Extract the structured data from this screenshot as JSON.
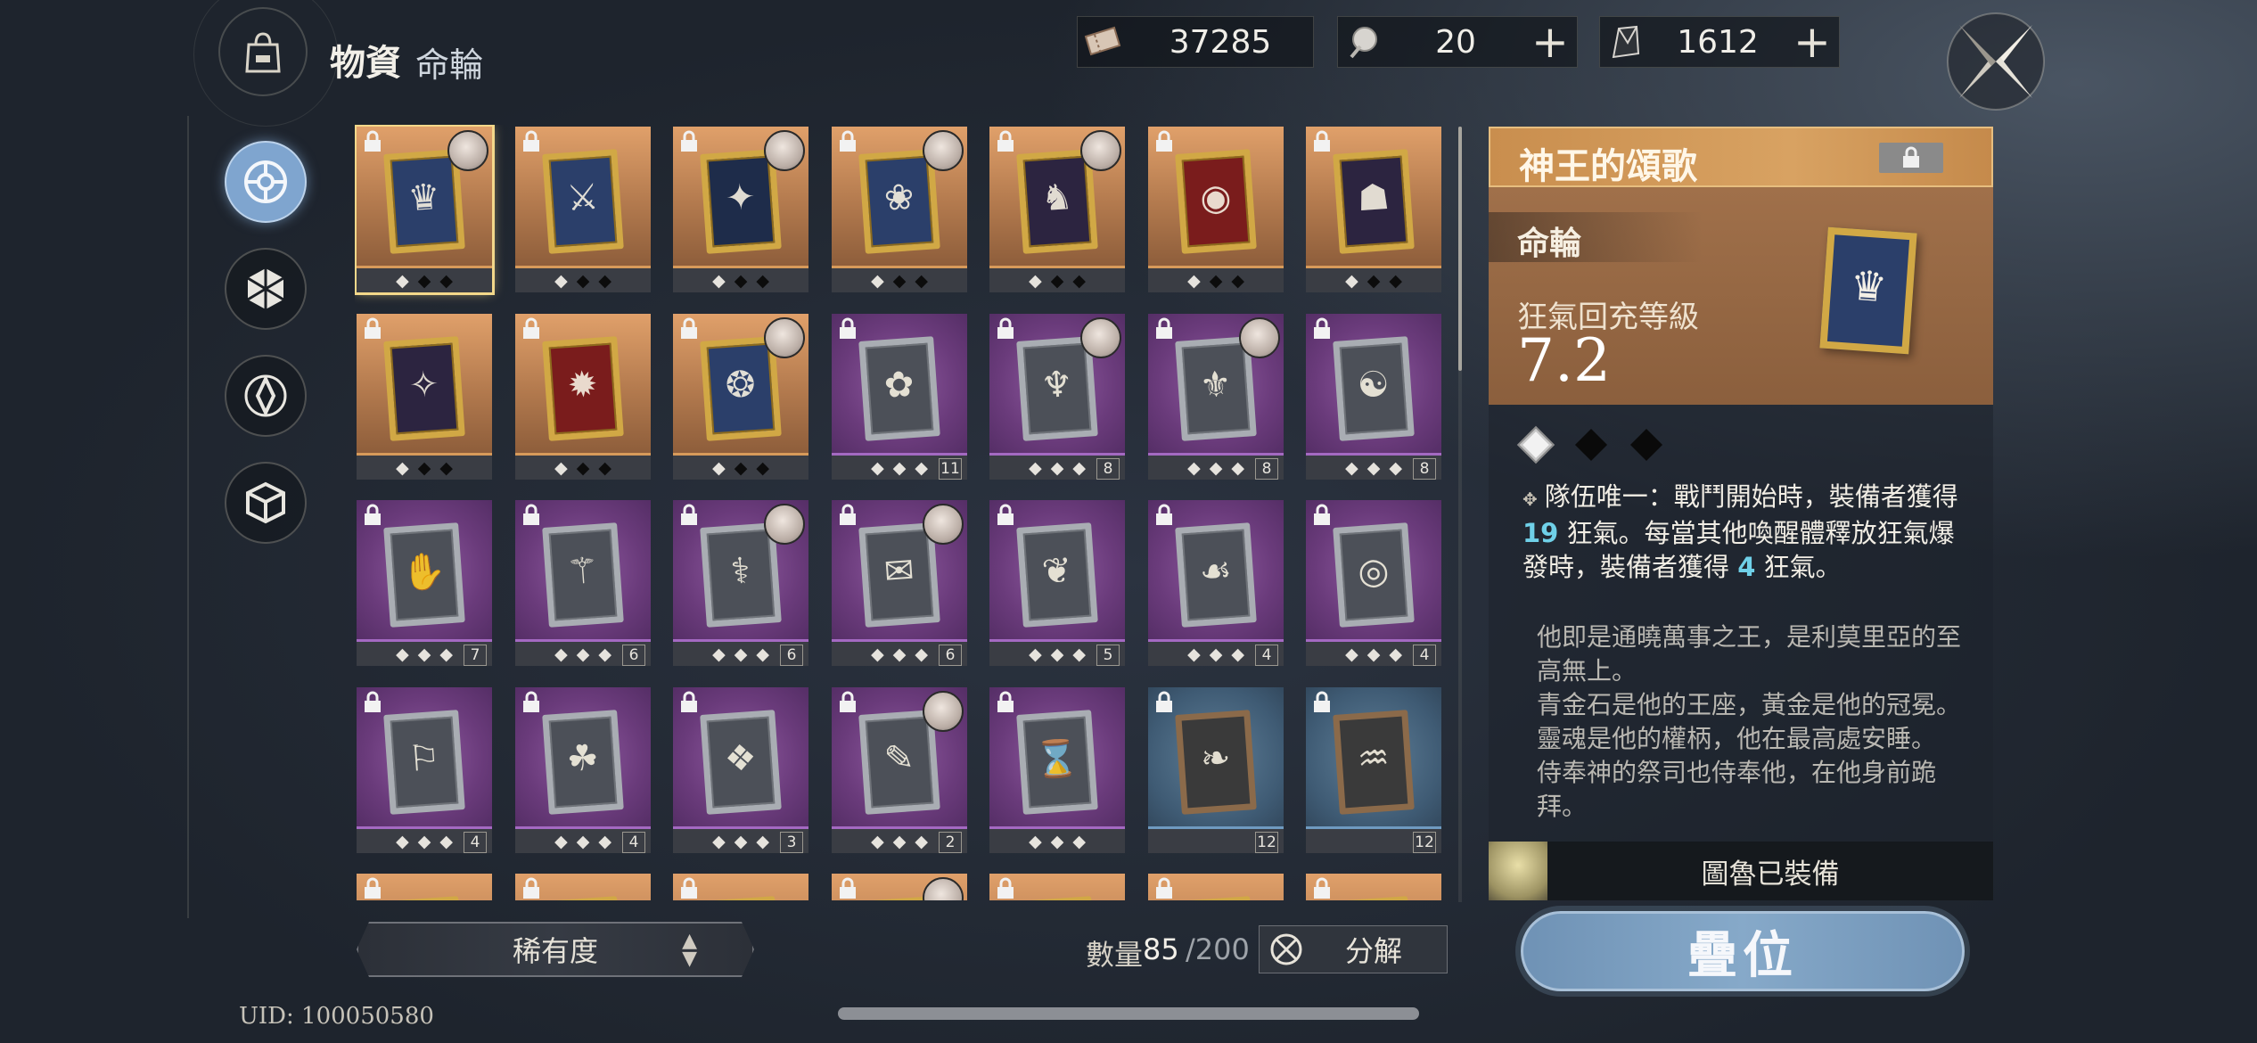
{
  "header": {
    "title": "物資",
    "subtitle": "命輪",
    "currencies": [
      {
        "icon": "ticket-icon",
        "value": "37285"
      },
      {
        "icon": "orb-icon",
        "value": "20"
      },
      {
        "icon": "crystal-icon",
        "value": "1612"
      }
    ],
    "plus_label": "+"
  },
  "side_nav": [
    {
      "icon": "wheel-icon",
      "active": true
    },
    {
      "icon": "hexagon-icon",
      "active": false
    },
    {
      "icon": "diamond-compass-icon",
      "active": false
    },
    {
      "icon": "cube-icon",
      "active": false
    }
  ],
  "grid": {
    "cards": [
      {
        "rarity": "gold",
        "glyph": "♛",
        "avatar": true,
        "levels": [
          "◆",
          "◆",
          "◆"
        ],
        "level_num": "",
        "selected": true,
        "art": ""
      },
      {
        "rarity": "gold",
        "glyph": "⚔",
        "avatar": false,
        "levels": [
          "◆",
          "◆",
          "◆"
        ],
        "level_num": "",
        "selected": false,
        "art": ""
      },
      {
        "rarity": "gold",
        "glyph": "✦",
        "avatar": true,
        "levels": [
          "◆",
          "◆",
          "◆"
        ],
        "level_num": "",
        "selected": false,
        "art": "navy"
      },
      {
        "rarity": "gold",
        "glyph": "❀",
        "avatar": true,
        "levels": [
          "◆",
          "◆",
          "◆"
        ],
        "level_num": "",
        "selected": false,
        "art": ""
      },
      {
        "rarity": "gold",
        "glyph": "♞",
        "avatar": true,
        "levels": [
          "◆",
          "◆",
          "◆"
        ],
        "level_num": "",
        "selected": false,
        "art": "dark"
      },
      {
        "rarity": "gold",
        "glyph": "◉",
        "avatar": false,
        "levels": [
          "◆",
          "◆",
          "◆"
        ],
        "level_num": "",
        "selected": false,
        "art": "red"
      },
      {
        "rarity": "gold",
        "glyph": "☗",
        "avatar": false,
        "levels": [
          "◆",
          "◆",
          "◆"
        ],
        "level_num": "",
        "selected": false,
        "art": "dark"
      },
      {
        "rarity": "gold",
        "glyph": "✧",
        "avatar": false,
        "levels": [
          "◆",
          "◆",
          "◆"
        ],
        "level_num": "",
        "selected": false,
        "art": "dark"
      },
      {
        "rarity": "gold",
        "glyph": "✹",
        "avatar": false,
        "levels": [
          "◆",
          "◆",
          "◆"
        ],
        "level_num": "",
        "selected": false,
        "art": "red"
      },
      {
        "rarity": "gold",
        "glyph": "❂",
        "avatar": true,
        "levels": [
          "◆",
          "◆",
          "◆"
        ],
        "level_num": "",
        "selected": false,
        "art": ""
      },
      {
        "rarity": "purple",
        "glyph": "✿",
        "avatar": false,
        "levels": [
          "◆",
          "◆",
          "◆"
        ],
        "level_num": "11",
        "selected": false,
        "art": ""
      },
      {
        "rarity": "purple",
        "glyph": "♆",
        "avatar": true,
        "levels": [
          "◆",
          "◆",
          "◆"
        ],
        "level_num": "8",
        "selected": false,
        "art": ""
      },
      {
        "rarity": "purple",
        "glyph": "⚜",
        "avatar": true,
        "levels": [
          "◆",
          "◆",
          "◆"
        ],
        "level_num": "8",
        "selected": false,
        "art": ""
      },
      {
        "rarity": "purple",
        "glyph": "☯",
        "avatar": false,
        "levels": [
          "◆",
          "◆",
          "◆"
        ],
        "level_num": "8",
        "selected": false,
        "art": ""
      },
      {
        "rarity": "purple",
        "glyph": "✋",
        "avatar": false,
        "levels": [
          "◆",
          "◆",
          "◆"
        ],
        "level_num": "7",
        "selected": false,
        "art": ""
      },
      {
        "rarity": "purple",
        "glyph": "⚚",
        "avatar": false,
        "levels": [
          "◆",
          "◆",
          "◆"
        ],
        "level_num": "6",
        "selected": false,
        "art": ""
      },
      {
        "rarity": "purple",
        "glyph": "⚕",
        "avatar": true,
        "levels": [
          "◆",
          "◆",
          "◆"
        ],
        "level_num": "6",
        "selected": false,
        "art": ""
      },
      {
        "rarity": "purple",
        "glyph": "✉",
        "avatar": true,
        "levels": [
          "◆",
          "◆",
          "◆"
        ],
        "level_num": "6",
        "selected": false,
        "art": ""
      },
      {
        "rarity": "purple",
        "glyph": "❦",
        "avatar": false,
        "levels": [
          "◆",
          "◆",
          "◆"
        ],
        "level_num": "5",
        "selected": false,
        "art": ""
      },
      {
        "rarity": "purple",
        "glyph": "☙",
        "avatar": false,
        "levels": [
          "◆",
          "◆",
          "◆"
        ],
        "level_num": "4",
        "selected": false,
        "art": ""
      },
      {
        "rarity": "purple",
        "glyph": "◎",
        "avatar": false,
        "levels": [
          "◆",
          "◆",
          "◆"
        ],
        "level_num": "4",
        "selected": false,
        "art": ""
      },
      {
        "rarity": "purple",
        "glyph": "⚐",
        "avatar": false,
        "levels": [
          "◆",
          "◆",
          "◆"
        ],
        "level_num": "4",
        "selected": false,
        "art": ""
      },
      {
        "rarity": "purple",
        "glyph": "☘",
        "avatar": false,
        "levels": [
          "◆",
          "◆",
          "◆"
        ],
        "level_num": "4",
        "selected": false,
        "art": ""
      },
      {
        "rarity": "purple",
        "glyph": "❖",
        "avatar": false,
        "levels": [
          "◆",
          "◆",
          "◆"
        ],
        "level_num": "3",
        "selected": false,
        "art": ""
      },
      {
        "rarity": "purple",
        "glyph": "✎",
        "avatar": true,
        "levels": [
          "◆",
          "◆",
          "◆"
        ],
        "level_num": "2",
        "selected": false,
        "art": ""
      },
      {
        "rarity": "purple",
        "glyph": "⌛",
        "avatar": false,
        "levels": [
          "◆",
          "◆",
          "◆"
        ],
        "level_num": "",
        "selected": false,
        "art": ""
      },
      {
        "rarity": "blue",
        "glyph": "❧",
        "avatar": false,
        "levels": [],
        "level_num": "12",
        "selected": false,
        "art": ""
      },
      {
        "rarity": "blue",
        "glyph": "♒",
        "avatar": false,
        "levels": [],
        "level_num": "12",
        "selected": false,
        "art": ""
      },
      {
        "rarity": "gold",
        "glyph": "",
        "avatar": false,
        "levels": [],
        "level_num": "",
        "selected": false,
        "art": ""
      },
      {
        "rarity": "gold",
        "glyph": "",
        "avatar": false,
        "levels": [],
        "level_num": "",
        "selected": false,
        "art": ""
      },
      {
        "rarity": "gold",
        "glyph": "",
        "avatar": false,
        "levels": [],
        "level_num": "",
        "selected": false,
        "art": ""
      },
      {
        "rarity": "gold",
        "glyph": "",
        "avatar": true,
        "levels": [],
        "level_num": "",
        "selected": false,
        "art": ""
      },
      {
        "rarity": "gold",
        "glyph": "",
        "avatar": false,
        "levels": [],
        "level_num": "",
        "selected": false,
        "art": ""
      },
      {
        "rarity": "gold",
        "glyph": "",
        "avatar": false,
        "levels": [],
        "level_num": "",
        "selected": false,
        "art": ""
      },
      {
        "rarity": "gold",
        "glyph": "",
        "avatar": false,
        "levels": [],
        "level_num": "",
        "selected": false,
        "art": ""
      }
    ]
  },
  "bottom": {
    "sort_label": "稀有度",
    "sort_arrows": "▲▼",
    "count_label": "數量",
    "count_value": "85",
    "count_max": "/200",
    "dismantle_label": "分解",
    "uid": "UID: 100050580"
  },
  "detail": {
    "title": "神王的頌歌",
    "type": "命輪",
    "stat_label": "狂氣回充等級",
    "stat_value": "7.2",
    "diamonds": [
      "empty",
      "filled",
      "filled"
    ],
    "effect_parts": [
      "隊伍唯一：戰鬥開始時，裝備者獲得 ",
      "19",
      " 狂氣。每當其他喚醒體釋放狂氣爆發時，裝備者獲得 ",
      "4",
      " 狂氣。"
    ],
    "lore": [
      "他即是通曉萬事之王，是利莫里亞的至高無上。",
      "青金石是他的王座，黃金是他的冠冕。靈魂是他的權柄，他在最高處安睡。",
      "侍奉神的祭司也侍奉他，在他身前跪拜。"
    ],
    "equipped_text": "圖魯已裝備",
    "stack_button": "疊位"
  }
}
